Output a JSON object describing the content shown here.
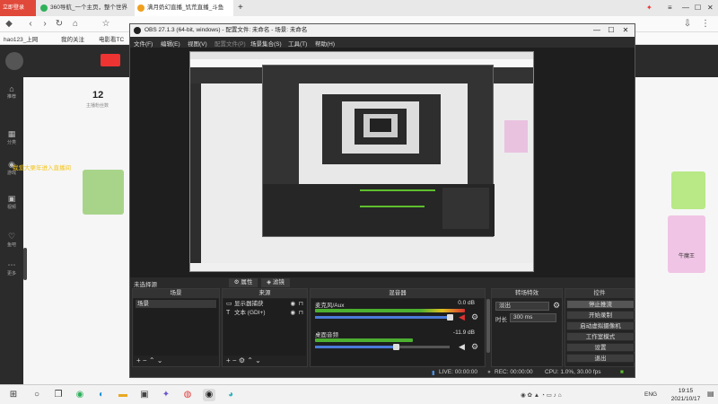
{
  "browser": {
    "tabs": [
      {
        "label": "360导航_一个主页，整个世界",
        "color": "#2fb15b"
      },
      {
        "label": "满月奶幻直播_饥荒直播_斗鱼",
        "color": "#f0a020"
      }
    ],
    "new_tab": "+",
    "brand_badge": "立即登录",
    "address": "https://www.douyu.com/4610253",
    "bookmarks": [
      {
        "label": "hao123_上网"
      },
      {
        "label": "我的关注"
      },
      {
        "label": "电影看TC"
      }
    ],
    "site": {
      "stat_value": "12",
      "stat_label": "主播粉丝数",
      "announcement": "我爱大栗年进入直播间",
      "promo_label": "牛魔王",
      "rail": [
        {
          "icon": "home-icon",
          "glyph": "⌂",
          "label": "推荐"
        },
        {
          "icon": "category-icon",
          "glyph": "▦",
          "label": "分类"
        },
        {
          "icon": "game-icon",
          "glyph": "◉",
          "label": "游戏"
        },
        {
          "icon": "video-icon",
          "glyph": "▣",
          "label": "视频"
        },
        {
          "icon": "club-icon",
          "glyph": "♡",
          "label": "鱼吧"
        },
        {
          "icon": "more-icon",
          "glyph": "⋯",
          "label": "更多"
        }
      ]
    }
  },
  "obs": {
    "title": "OBS 27.1.3 (64-bit, windows) - 配置文件: 未命名 - 场景: 未命名",
    "window_controls": {
      "minimize": "—",
      "maximize": "☐",
      "close": "✕"
    },
    "menu": [
      {
        "label": "文件(F)",
        "enabled": true
      },
      {
        "label": "编辑(E)",
        "enabled": true
      },
      {
        "label": "视图(V)",
        "enabled": true
      },
      {
        "label": "配置文件(P)",
        "enabled": false
      },
      {
        "label": "场景集合(S)",
        "enabled": true
      },
      {
        "label": "工具(T)",
        "enabled": true
      },
      {
        "label": "帮助(H)",
        "enabled": true
      }
    ],
    "scene_status": "未选择源",
    "properties_button": "属性",
    "filters_button": "滤镜",
    "docks": {
      "scenes": {
        "title": "场景",
        "items": [
          "场景"
        ]
      },
      "sources": {
        "title": "来源",
        "items": [
          {
            "label": "显示器捕获",
            "icon": "monitor-icon"
          },
          {
            "label": "文本 (GDI+)",
            "icon": "text-icon"
          }
        ]
      },
      "mixer": {
        "title": "混音器",
        "tracks": [
          {
            "name": "麦克风/Aux",
            "db": "0.0 dB",
            "level": 0.95,
            "volume": 1.0,
            "muted": true
          },
          {
            "name": "桌面音频",
            "db": "-11.9 dB",
            "level": 0.62,
            "volume": 0.6,
            "muted": false
          }
        ]
      },
      "transitions": {
        "title": "转场特效",
        "type": "淡出",
        "duration_label": "时长",
        "duration": "300 ms"
      },
      "controls": {
        "title": "控件",
        "buttons": [
          {
            "label": "停止推流",
            "active": true
          },
          {
            "label": "开始录制",
            "active": false
          },
          {
            "label": "启动虚拟摄像机",
            "active": false
          },
          {
            "label": "工作室模式",
            "active": false
          },
          {
            "label": "设置",
            "active": false
          },
          {
            "label": "退出",
            "active": false
          }
        ]
      }
    },
    "status": {
      "live": "LIVE: 00:00:00",
      "rec": "REC: 00:00:00",
      "cpu": "CPU: 1.0%, 30.00 fps"
    }
  },
  "taskbar": {
    "time": "19:15",
    "date": "2021/10/17",
    "lang": "ENG",
    "apps": [
      {
        "name": "start-icon",
        "glyph": "⊞"
      },
      {
        "name": "search-icon",
        "glyph": "○"
      },
      {
        "name": "taskview-icon",
        "glyph": "❐"
      },
      {
        "name": "mail-icon",
        "glyph": "✉"
      },
      {
        "name": "chrome-icon",
        "glyph": "◉"
      },
      {
        "name": "edge-icon",
        "glyph": "◐"
      },
      {
        "name": "explorer-icon",
        "glyph": "▬"
      },
      {
        "name": "store-icon",
        "glyph": "▣"
      },
      {
        "name": "app-icon",
        "glyph": "✦"
      },
      {
        "name": "netease-icon",
        "glyph": "◍"
      },
      {
        "name": "obs-icon",
        "glyph": "◉"
      },
      {
        "name": "browser-icon",
        "glyph": "◕"
      }
    ]
  }
}
